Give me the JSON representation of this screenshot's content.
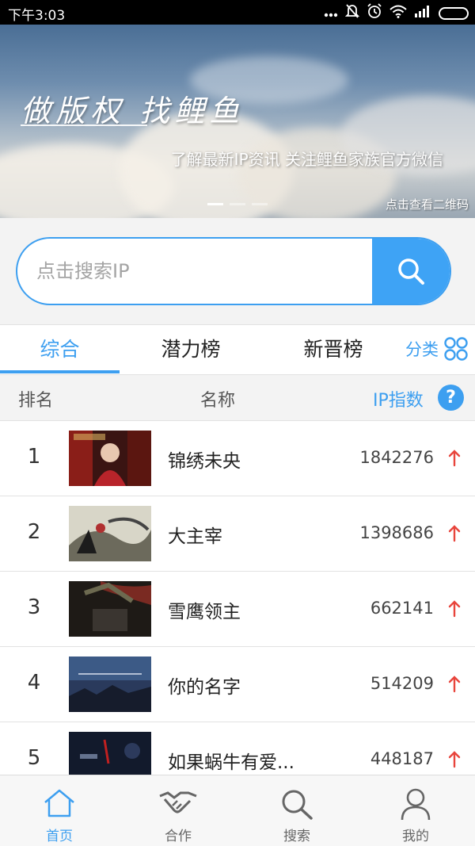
{
  "status_bar": {
    "time": "下午3:03"
  },
  "banner": {
    "slogan": "做版权 找鲤鱼",
    "subtitle": "了解最新IP资讯 关注鲤鱼家族官方微信",
    "qr_link": "点击查看二维码",
    "slide_count": 3,
    "active_slide": 1
  },
  "search": {
    "placeholder": "点击搜索IP",
    "value": ""
  },
  "tabs": [
    {
      "label": "综合",
      "active": true
    },
    {
      "label": "潜力榜",
      "active": false
    },
    {
      "label": "新晋榜",
      "active": false
    }
  ],
  "category": {
    "label": "分类"
  },
  "list_header": {
    "rank": "排名",
    "name": "名称",
    "index": "IP指数"
  },
  "rankings": [
    {
      "rank": "1",
      "title": "锦绣未央",
      "score": "1842276",
      "trend": "up"
    },
    {
      "rank": "2",
      "title": "大主宰",
      "score": "1398686",
      "trend": "up"
    },
    {
      "rank": "3",
      "title": "雪鹰领主",
      "score": "662141",
      "trend": "up"
    },
    {
      "rank": "4",
      "title": "你的名字",
      "score": "514209",
      "trend": "up"
    },
    {
      "rank": "5",
      "title": "如果蜗牛有爱...",
      "score": "448187",
      "trend": "up"
    }
  ],
  "bottom_nav": [
    {
      "label": "首页",
      "icon": "home-icon",
      "active": true
    },
    {
      "label": "合作",
      "icon": "handshake-icon",
      "active": false
    },
    {
      "label": "搜索",
      "icon": "search-icon",
      "active": false
    },
    {
      "label": "我的",
      "icon": "user-icon",
      "active": false
    }
  ],
  "colors": {
    "accent": "#3d9ff0",
    "trend_up": "#e8453c",
    "status_bar": "#000000"
  }
}
